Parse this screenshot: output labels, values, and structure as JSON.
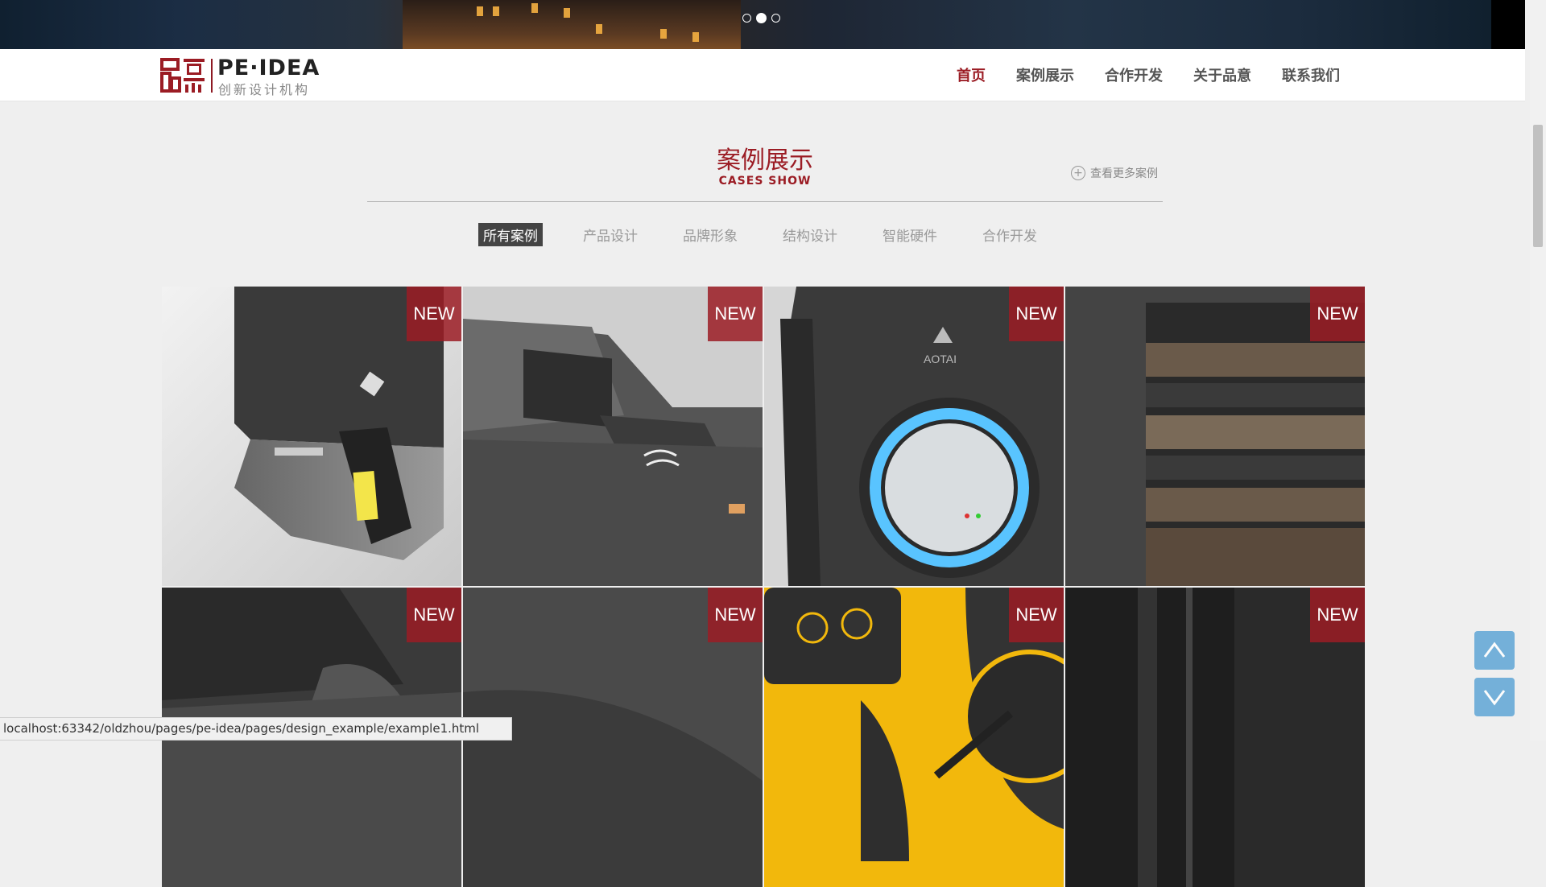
{
  "banner": {
    "slide_count": 3,
    "active_slide": 2
  },
  "brand": {
    "logo_en": "PE·IDEA",
    "logo_cn": "创新设计机构",
    "accent_color": "#9b1c24"
  },
  "nav": {
    "items": [
      {
        "label": "首页",
        "active": true
      },
      {
        "label": "案例展示",
        "active": false
      },
      {
        "label": "合作开发",
        "active": false
      },
      {
        "label": "关于品意",
        "active": false
      },
      {
        "label": "联系我们",
        "active": false
      }
    ]
  },
  "section": {
    "title_cn": "案例展示",
    "title_en": "CASES SHOW",
    "more_label": "查看更多案例"
  },
  "filters": {
    "tabs": [
      {
        "label": "所有案例",
        "active": true
      },
      {
        "label": "产品设计",
        "active": false
      },
      {
        "label": "品牌形象",
        "active": false
      },
      {
        "label": "结构设计",
        "active": false
      },
      {
        "label": "智能硬件",
        "active": false
      },
      {
        "label": "合作开发",
        "active": false
      }
    ]
  },
  "cases": [
    {
      "badge": "NEW",
      "icon": "fingerprint-terminal-image"
    },
    {
      "badge": "NEW",
      "icon": "access-turnstile-image"
    },
    {
      "badge": "NEW",
      "icon": "aotai-reader-image"
    },
    {
      "badge": "NEW",
      "icon": "speaker-tower-image"
    },
    {
      "badge": "NEW",
      "icon": "device-closeup-image"
    },
    {
      "badge": "NEW",
      "icon": "dark-panel-image"
    },
    {
      "badge": "NEW",
      "icon": "yellow-controller-image"
    },
    {
      "badge": "NEW",
      "icon": "black-column-image"
    }
  ],
  "status_bar": {
    "url": "localhost:63342/oldzhou/pages/pe-idea/pages/design_example/example1.html"
  },
  "float_buttons": {
    "up": "^",
    "down": "v"
  }
}
